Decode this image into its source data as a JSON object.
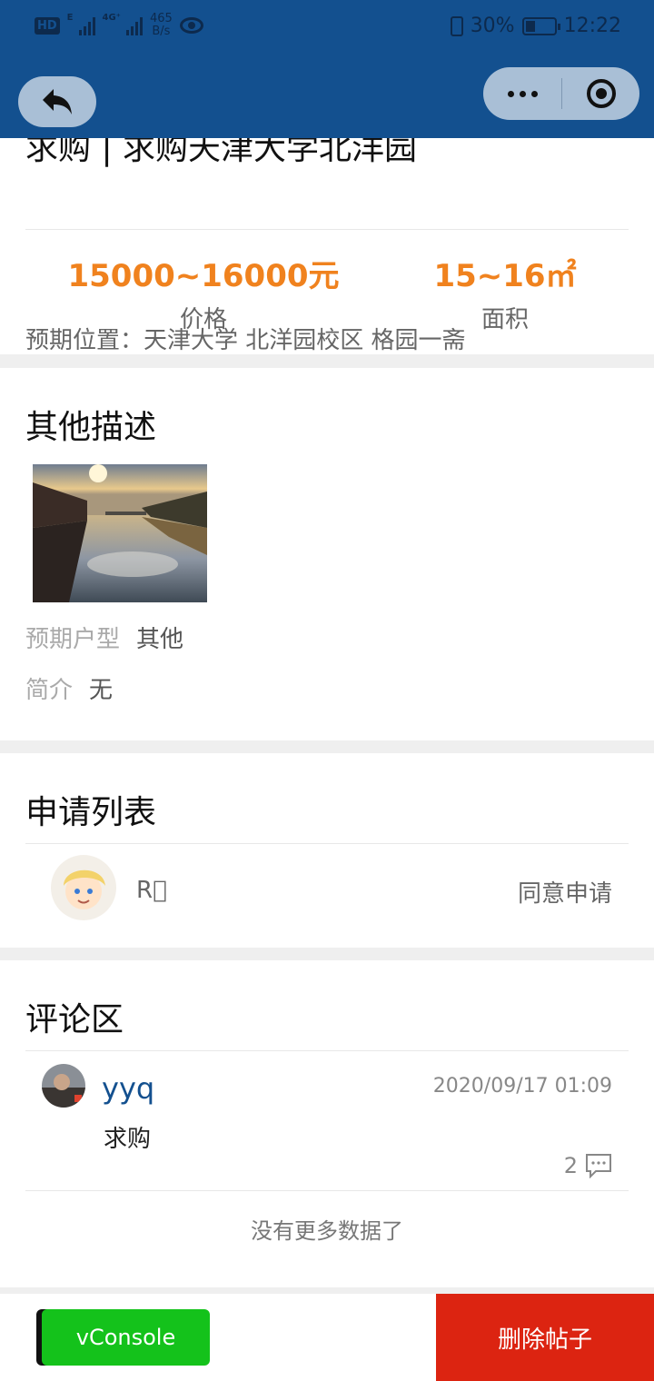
{
  "status_bar": {
    "hd": "HD",
    "net_a": "E",
    "net_b": "4G⁺",
    "speed_value": "465",
    "speed_unit": "B/s",
    "battery": "30%",
    "time": "12:22"
  },
  "post": {
    "title": "求购 | 求购天津大学北洋园",
    "location": "预期位置：天津大学 北洋园校区 格园一斋",
    "price_value": "15000~16000元",
    "price_label": "价格",
    "area_value": "15~16㎡",
    "area_label": "面积"
  },
  "description": {
    "title": "其他描述",
    "house_type_label": "预期户型",
    "house_type_value": "其他",
    "intro_label": "简介",
    "intro_value": "无"
  },
  "applications": {
    "title": "申请列表",
    "items": [
      {
        "name": "R\u0000",
        "action": "同意申请"
      }
    ]
  },
  "comments": {
    "title": "评论区",
    "items": [
      {
        "user": "yyq",
        "time": "2020/09/17 01:09",
        "text": "求购",
        "reply_count": "2"
      }
    ],
    "no_more": "没有更多数据了"
  },
  "bottom_bar": {
    "vconsole": "vConsole",
    "delete": "删除帖子"
  },
  "colors": {
    "header": "#13508f",
    "accent_orange": "#f0821e",
    "delete_red": "#dc2411",
    "vconsole_green": "#14c21b",
    "username_blue": "#13508f"
  },
  "icons": [
    "back-arrow-icon",
    "more-dots-icon",
    "target-icon",
    "comment-icon",
    "eye-icon",
    "battery-icon",
    "vibrate-icon",
    "signal-icon"
  ]
}
